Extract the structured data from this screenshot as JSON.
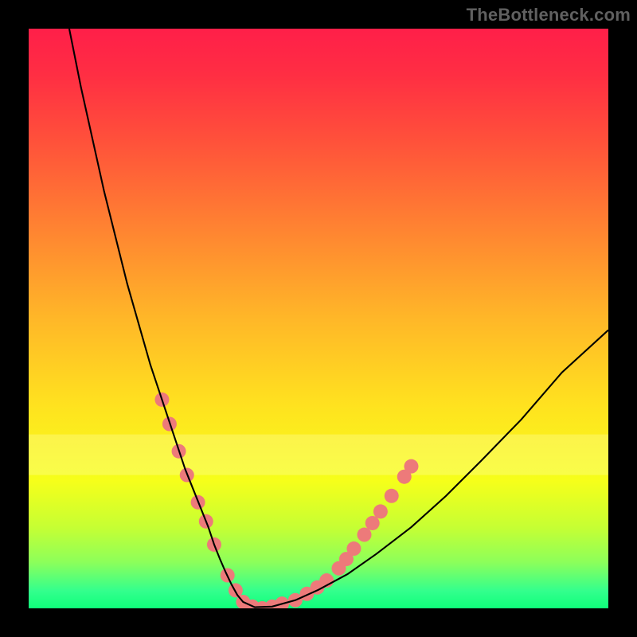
{
  "watermark": "TheBottleneck.com",
  "chart_data": {
    "type": "line",
    "title": "",
    "xlabel": "",
    "ylabel": "",
    "xlim": [
      0,
      100
    ],
    "ylim": [
      0,
      100
    ],
    "background_gradient_stops": [
      {
        "offset": 0.0,
        "color": "#ff1f49"
      },
      {
        "offset": 0.08,
        "color": "#ff2e43"
      },
      {
        "offset": 0.2,
        "color": "#ff533a"
      },
      {
        "offset": 0.35,
        "color": "#ff8531"
      },
      {
        "offset": 0.5,
        "color": "#ffb728"
      },
      {
        "offset": 0.65,
        "color": "#ffe21f"
      },
      {
        "offset": 0.78,
        "color": "#f6ff1a"
      },
      {
        "offset": 0.86,
        "color": "#c6ff33"
      },
      {
        "offset": 0.92,
        "color": "#8dff5a"
      },
      {
        "offset": 0.97,
        "color": "#33ff8d"
      },
      {
        "offset": 1.0,
        "color": "#0fff7a"
      }
    ],
    "series": [
      {
        "name": "curve",
        "color": "#000000",
        "x": [
          7,
          9,
          11,
          13,
          15,
          17,
          19,
          21,
          23,
          25,
          27,
          29,
          31,
          32,
          33,
          34,
          35,
          36,
          37,
          39,
          42,
          46,
          50,
          55,
          60,
          66,
          72,
          78,
          85,
          92,
          100
        ],
        "y": [
          100,
          90,
          81,
          72,
          64,
          56,
          49,
          42,
          36,
          30,
          24,
          19,
          14,
          11,
          8.5,
          6.2,
          4.1,
          2.3,
          1.1,
          0.2,
          0.3,
          1.4,
          3.2,
          5.9,
          9.4,
          14.0,
          19.4,
          25.4,
          32.6,
          40.7,
          48.0
        ]
      }
    ],
    "marker_points": {
      "color": "#ed7a7a",
      "radius": 9,
      "points": [
        {
          "x": 23.0,
          "y": 36.0
        },
        {
          "x": 24.3,
          "y": 31.8
        },
        {
          "x": 25.9,
          "y": 27.1
        },
        {
          "x": 27.3,
          "y": 23.0
        },
        {
          "x": 29.2,
          "y": 18.3
        },
        {
          "x": 30.6,
          "y": 15.0
        },
        {
          "x": 32.0,
          "y": 11.0
        },
        {
          "x": 34.3,
          "y": 5.7
        },
        {
          "x": 35.7,
          "y": 3.1
        },
        {
          "x": 37.0,
          "y": 1.1
        },
        {
          "x": 38.6,
          "y": 0.3
        },
        {
          "x": 40.3,
          "y": 0.0
        },
        {
          "x": 42.0,
          "y": 0.3
        },
        {
          "x": 43.7,
          "y": 0.8
        },
        {
          "x": 46.0,
          "y": 1.4
        },
        {
          "x": 48.0,
          "y": 2.5
        },
        {
          "x": 49.8,
          "y": 3.6
        },
        {
          "x": 51.4,
          "y": 4.8
        },
        {
          "x": 53.5,
          "y": 6.9
        },
        {
          "x": 54.8,
          "y": 8.5
        },
        {
          "x": 56.1,
          "y": 10.3
        },
        {
          "x": 57.9,
          "y": 12.7
        },
        {
          "x": 59.3,
          "y": 14.7
        },
        {
          "x": 60.7,
          "y": 16.7
        },
        {
          "x": 62.6,
          "y": 19.4
        },
        {
          "x": 64.8,
          "y": 22.7
        },
        {
          "x": 66.0,
          "y": 24.5
        }
      ]
    },
    "pale_band": {
      "y0": 70,
      "y1": 77,
      "color": "#ffffa6",
      "opacity": 0.33
    }
  }
}
